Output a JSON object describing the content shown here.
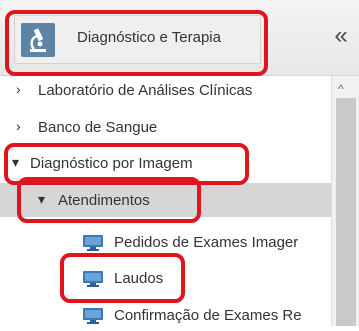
{
  "header": {
    "module_label": "Diagnóstico e Terapia",
    "module_icon": "microscope-icon",
    "collapse_glyph": "«"
  },
  "tree": {
    "items": [
      {
        "label": "Laboratório de Análises Clínicas",
        "arrow": "›",
        "state": "collapsed"
      },
      {
        "label": "Banco de Sangue",
        "arrow": "›",
        "state": "collapsed"
      },
      {
        "label": "Diagnóstico por Imagem",
        "arrow": "▾",
        "state": "expanded"
      },
      {
        "label": "Atendimentos",
        "arrow": "▾",
        "state": "expanded"
      },
      {
        "label": "Pedidos de Exames Imager",
        "icon": "monitor-icon"
      },
      {
        "label": "Laudos",
        "icon": "monitor-icon"
      },
      {
        "label": "Confirmação de Exames Re",
        "icon": "monitor-icon"
      }
    ]
  },
  "scrollbar": {
    "up_glyph": "^"
  },
  "colors": {
    "highlight": "#e0141c",
    "icon_blue": "#3a78b8",
    "selected_bg": "#d6d6d6"
  }
}
